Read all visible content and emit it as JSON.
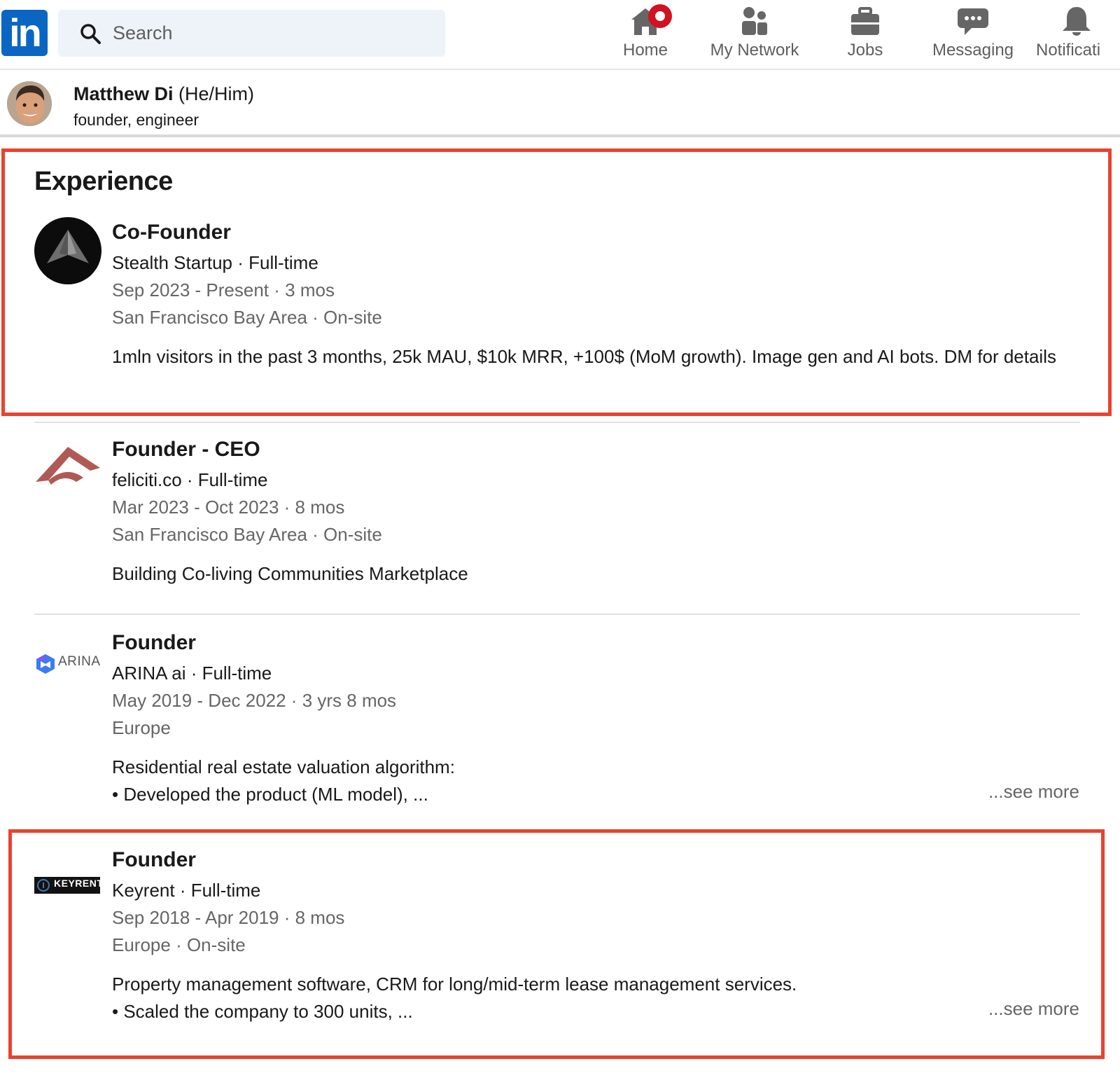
{
  "nav": {
    "logo_text": "in",
    "search_placeholder": "Search",
    "items": [
      {
        "label": "Home",
        "icon": "home-icon",
        "has_badge": true
      },
      {
        "label": "My Network",
        "icon": "people-icon"
      },
      {
        "label": "Jobs",
        "icon": "briefcase-icon"
      },
      {
        "label": "Messaging",
        "icon": "chat-icon"
      },
      {
        "label": "Notificati",
        "icon": "bell-icon"
      }
    ]
  },
  "profile": {
    "name": "Matthew Di",
    "pronouns": "(He/Him)",
    "headline": "founder, engineer"
  },
  "experience": {
    "title": "Experience",
    "entries": [
      {
        "title": "Co-Founder",
        "company": "Stealth Startup · Full-time",
        "dates": "Sep 2023 - Present · 3 mos",
        "location": "San Francisco Bay Area · On-site",
        "description": "1mln visitors in the past 3 months, 25k MAU, $10k MRR, +100$ (MoM growth). Image gen and AI bots. DM for details"
      },
      {
        "title": "Founder - CEO",
        "company": "feliciti.co · Full-time",
        "dates": "Mar 2023 - Oct 2023 · 8 mos",
        "location": "San Francisco Bay Area · On-site",
        "description": "Building Co-living Communities Marketplace"
      },
      {
        "title": "Founder",
        "company": "ARINA ai · Full-time",
        "dates": "May 2019 - Dec 2022 · 3 yrs 8 mos",
        "location": "Europe",
        "description_line1": "Residential real estate valuation algorithm:",
        "description_line2": "• Developed the product (ML model), ...",
        "see_more": "...see more",
        "logo_text": "ARINA"
      },
      {
        "title": "Founder",
        "company": "Keyrent · Full-time",
        "dates": "Sep 2018 - Apr 2019 · 8 mos",
        "location": "Europe · On-site",
        "description_line1": "Property management software, CRM for long/mid-term lease management services.",
        "description_line2": "• Scaled the company to 300 units, ...",
        "see_more": "...see more",
        "logo_text": "KEYRENT"
      }
    ]
  },
  "colors": {
    "brand": "#0a66c2",
    "highlight": "#e8432e",
    "notification_badge": "#d11124"
  }
}
